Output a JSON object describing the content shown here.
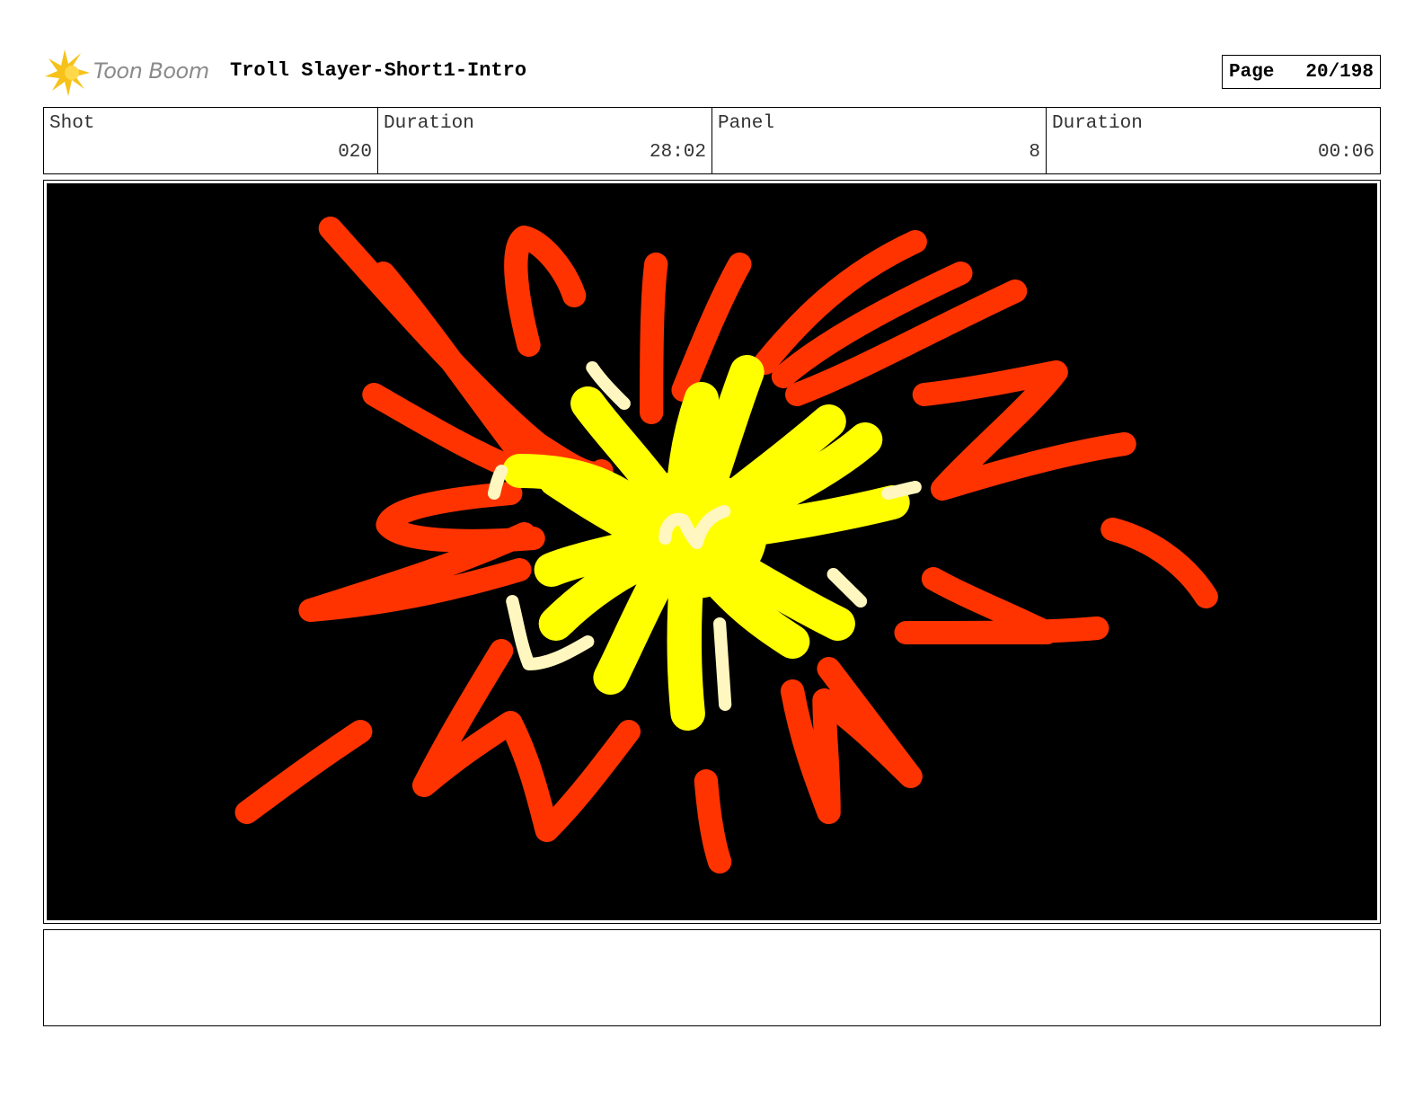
{
  "header": {
    "logo_text": "Toon Boom",
    "title": "Troll Slayer-Short1-Intro",
    "page_label": "Page",
    "page_value": "20/198"
  },
  "info": [
    {
      "label": "Shot",
      "value": "020"
    },
    {
      "label": "Duration",
      "value": "28:02"
    },
    {
      "label": "Panel",
      "value": "8"
    },
    {
      "label": "Duration",
      "value": "00:06"
    }
  ],
  "panel": {
    "background_color": "#000000",
    "red_color": "#ff3300",
    "yellow_color": "#ffff00",
    "highlight_color": "#fff7bf"
  },
  "notes": {
    "text": ""
  }
}
